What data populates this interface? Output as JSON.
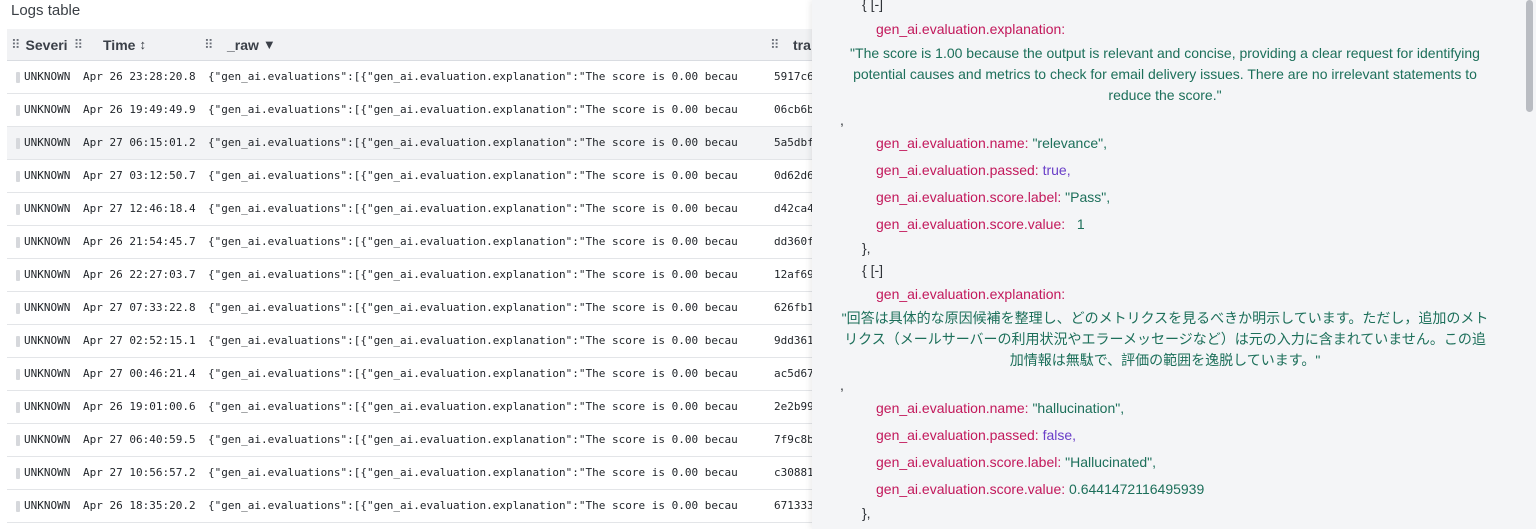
{
  "logs": {
    "title": "Logs table",
    "columns": {
      "severity": "Severi",
      "time": "Time",
      "time_sort": "↕",
      "raw": "_raw",
      "raw_sort": "▼",
      "trace": "tra"
    },
    "rows": [
      {
        "severity": "UNKNOWN",
        "time": "Apr 26 23:28:20.8",
        "raw": "{\"gen_ai.evaluations\":[{\"gen_ai.evaluation.explanation\":\"The score is 0.00 becau",
        "trace": "5917c6"
      },
      {
        "severity": "UNKNOWN",
        "time": "Apr 26 19:49:49.9",
        "raw": "{\"gen_ai.evaluations\":[{\"gen_ai.evaluation.explanation\":\"The score is 0.00 becau",
        "trace": "06cb6b"
      },
      {
        "severity": "UNKNOWN",
        "time": "Apr 27 06:15:01.2",
        "raw": "{\"gen_ai.evaluations\":[{\"gen_ai.evaluation.explanation\":\"The score is 0.00 becau",
        "trace": "5a5dbf"
      },
      {
        "severity": "UNKNOWN",
        "time": "Apr 27 03:12:50.7",
        "raw": "{\"gen_ai.evaluations\":[{\"gen_ai.evaluation.explanation\":\"The score is 0.00 becau",
        "trace": "0d62d6"
      },
      {
        "severity": "UNKNOWN",
        "time": "Apr 27 12:46:18.4",
        "raw": "{\"gen_ai.evaluations\":[{\"gen_ai.evaluation.explanation\":\"The score is 0.00 becau",
        "trace": "d42ca4"
      },
      {
        "severity": "UNKNOWN",
        "time": "Apr 26 21:54:45.7",
        "raw": "{\"gen_ai.evaluations\":[{\"gen_ai.evaluation.explanation\":\"The score is 0.00 becau",
        "trace": "dd360f"
      },
      {
        "severity": "UNKNOWN",
        "time": "Apr 26 22:27:03.7",
        "raw": "{\"gen_ai.evaluations\":[{\"gen_ai.evaluation.explanation\":\"The score is 0.00 becau",
        "trace": "12af69"
      },
      {
        "severity": "UNKNOWN",
        "time": "Apr 27 07:33:22.8",
        "raw": "{\"gen_ai.evaluations\":[{\"gen_ai.evaluation.explanation\":\"The score is 0.00 becau",
        "trace": "626fb1"
      },
      {
        "severity": "UNKNOWN",
        "time": "Apr 27 02:52:15.1",
        "raw": "{\"gen_ai.evaluations\":[{\"gen_ai.evaluation.explanation\":\"The score is 0.00 becau",
        "trace": "9dd361"
      },
      {
        "severity": "UNKNOWN",
        "time": "Apr 27 00:46:21.4",
        "raw": "{\"gen_ai.evaluations\":[{\"gen_ai.evaluation.explanation\":\"The score is 0.00 becau",
        "trace": "ac5d67"
      },
      {
        "severity": "UNKNOWN",
        "time": "Apr 26 19:01:00.6",
        "raw": "{\"gen_ai.evaluations\":[{\"gen_ai.evaluation.explanation\":\"The score is 0.00 becau",
        "trace": "2e2b99"
      },
      {
        "severity": "UNKNOWN",
        "time": "Apr 27 06:40:59.5",
        "raw": "{\"gen_ai.evaluations\":[{\"gen_ai.evaluation.explanation\":\"The score is 0.00 becau",
        "trace": "7f9c8b"
      },
      {
        "severity": "UNKNOWN",
        "time": "Apr 27 10:56:57.2",
        "raw": "{\"gen_ai.evaluations\":[{\"gen_ai.evaluation.explanation\":\"The score is 0.00 becau",
        "trace": "c30881"
      },
      {
        "severity": "UNKNOWN",
        "time": "Apr 26 18:35:20.2",
        "raw": "{\"gen_ai.evaluations\":[{\"gen_ai.evaluation.explanation\":\"The score is 0.00 becau",
        "trace": "671333"
      }
    ]
  },
  "detail": {
    "open_brace": "{ [-]",
    "eval1": {
      "explanation_key": "gen_ai.evaluation.explanation:",
      "explanation_value": "\"The score is 1.00 because the output is relevant and concise, providing a clear request for identifying potential causes and metrics to check for email delivery issues. There are no irrelevant statements to reduce the score.\"",
      "comma": ",",
      "name_key": "gen_ai.evaluation.name:",
      "name_value": "\"relevance\",",
      "passed_key": "gen_ai.evaluation.passed:",
      "passed_value": "true,",
      "label_key": "gen_ai.evaluation.score.label:",
      "label_value": "\"Pass\",",
      "score_key": "gen_ai.evaluation.score.value:",
      "score_value": "1",
      "close": "},"
    },
    "eval2": {
      "open": "{ [-]",
      "explanation_key": "gen_ai.evaluation.explanation:",
      "explanation_value": "\"回答は具体的な原因候補を整理し、どのメトリクスを見るべきか明示しています。ただし，追加のメトリクス（メールサーバーの利用状況やエラーメッセージなど）は元の入力に含まれていません。この追加情報は無駄で、評価の範囲を逸脱しています。\"",
      "comma": ",",
      "name_key": "gen_ai.evaluation.name:",
      "name_value": "\"hallucination\",",
      "passed_key": "gen_ai.evaluation.passed:",
      "passed_value": "false,",
      "label_key": "gen_ai.evaluation.score.label:",
      "label_value": "\"Hallucinated\",",
      "score_key": "gen_ai.evaluation.score.value:",
      "score_value": "0.6441472116495939",
      "close": "},"
    }
  }
}
